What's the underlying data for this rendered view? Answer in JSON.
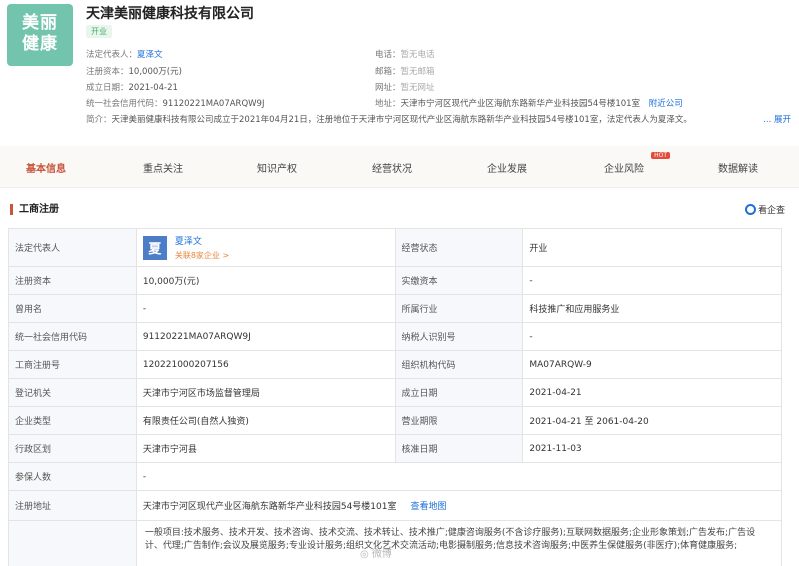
{
  "company": {
    "logo_line1": "美丽",
    "logo_line2": "健康",
    "name": "天津美丽健康科技有限公司",
    "status": "开业"
  },
  "header_info": {
    "legal_rep_label": "法定代表人：",
    "legal_rep": "夏泽文",
    "capital_label": "注册资本：",
    "capital": "10,000万(元)",
    "established_label": "成立日期：",
    "established": "2021-04-21",
    "credit_code_label": "统一社会信用代码：",
    "credit_code": "91120221MA07ARQW9J",
    "phone_label": "电话：",
    "phone": "暂无电话",
    "email_label": "邮箱：",
    "email": "暂无邮箱",
    "website_label": "网址：",
    "website": "暂无网址",
    "address_label": "地址：",
    "address": "天津市宁河区现代产业区海航东路新华产业科技园54号楼101室",
    "nearby_label": "附近公司",
    "summary_label": "简介：",
    "summary": "天津美丽健康科技有限公司成立于2021年04月21日，注册地位于天津市宁河区现代产业区海航东路新华产业科技园54号楼101室，法定代表人为夏泽文。",
    "expand_label": "... 展开"
  },
  "tabs": [
    {
      "label": "基本信息"
    },
    {
      "label": "重点关注"
    },
    {
      "label": "知识产权"
    },
    {
      "label": "经营状况"
    },
    {
      "label": "企业发展"
    },
    {
      "label": "企业风险",
      "badge": "HOT"
    },
    {
      "label": "数据解读"
    }
  ],
  "section": {
    "title": "工商注册",
    "qcc_label": "看企查"
  },
  "table": {
    "legal_rep_label": "法定代表人",
    "avatar_char": "夏",
    "legal_rep_name": "夏泽文",
    "legal_rep_sub": "关联8家企业 >",
    "biz_status_label": "经营状态",
    "biz_status": "开业",
    "rows": [
      {
        "l1": "注册资本",
        "v1": "10,000万(元)",
        "l2": "实缴资本",
        "v2": "-"
      },
      {
        "l1": "曾用名",
        "v1": "-",
        "l2": "所属行业",
        "v2": "科技推广和应用服务业"
      },
      {
        "l1": "统一社会信用代码",
        "v1": "91120221MA07ARQW9J",
        "l2": "纳税人识别号",
        "v2": "-"
      },
      {
        "l1": "工商注册号",
        "v1": "120221000207156",
        "l2": "组织机构代码",
        "v2": "MA07ARQW-9"
      },
      {
        "l1": "登记机关",
        "v1": "天津市宁河区市场监督管理局",
        "l2": "成立日期",
        "v2": "2021-04-21"
      },
      {
        "l1": "企业类型",
        "v1": "有限责任公司(自然人独资)",
        "l2": "营业期限",
        "v2": "2021-04-21 至 2061-04-20"
      },
      {
        "l1": "行政区划",
        "v1": "天津市宁河县",
        "l2": "核准日期",
        "v2": "2021-11-03"
      }
    ],
    "shareholders_label": "参保人数",
    "shareholders": "-",
    "address_label": "注册地址",
    "address": "天津市宁河区现代产业区海航东路新华产业科技园54号楼101室",
    "map_link": "查看地图",
    "scope": "一般项目:技术服务、技术开发、技术咨询、技术交流、技术转让、技术推广;健康咨询服务(不含诊疗服务);互联网数据服务;企业形象策划;广告发布;广告设计、代理;广告制作;会议及展览服务;专业设计服务;组织文化艺术交流活动;电影摄制服务;信息技术咨询服务;中医养生保健服务(非医疗);体育健康服务;"
  },
  "watermark": "◎ 微博"
}
